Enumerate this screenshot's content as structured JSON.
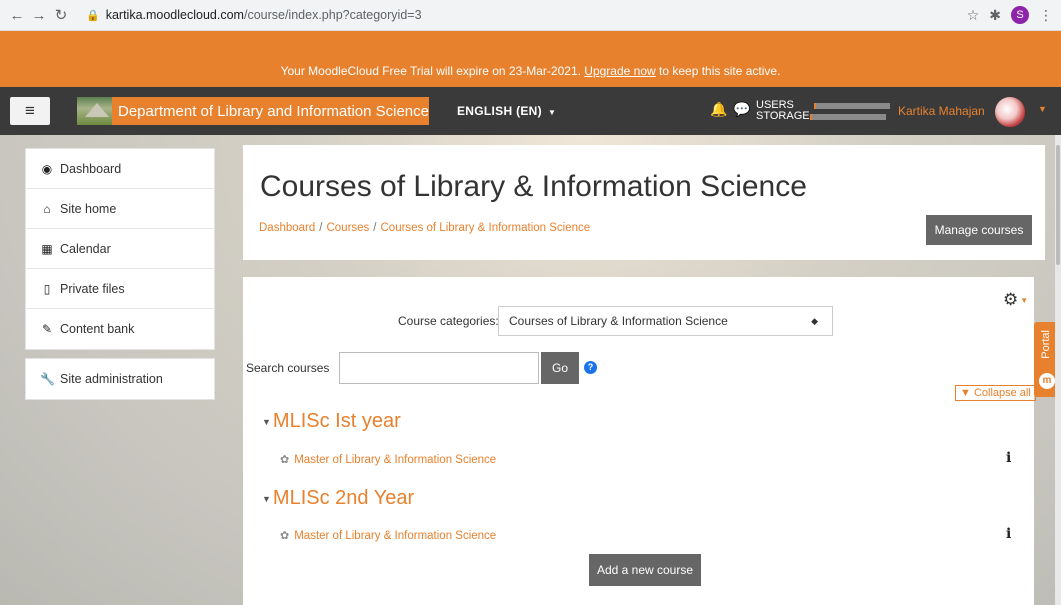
{
  "browser": {
    "url_host": "kartika.moodlecloud.com",
    "url_path": "/course/index.php?categoryid=3",
    "profile_initial": "S"
  },
  "notice": {
    "text_before": "Your MoodleCloud Free Trial will expire on 23-Mar-2021. ",
    "link": "Upgrade now",
    "text_after": " to keep this site active."
  },
  "navbar": {
    "site_name": "Department of Library and Information Science",
    "language": "ENGLISH (EN)",
    "users_label": "USERS",
    "storage_label": "STORAGE",
    "users_usage": 0.03,
    "storage_usage": 0.03,
    "user_name": "Kartika Mahajan"
  },
  "drawer": {
    "items": [
      {
        "label": "Dashboard",
        "icon": "dashboard-icon"
      },
      {
        "label": "Site home",
        "icon": "home-icon"
      },
      {
        "label": "Calendar",
        "icon": "calendar-icon"
      },
      {
        "label": "Private files",
        "icon": "file-icon"
      },
      {
        "label": "Content bank",
        "icon": "brush-icon"
      }
    ],
    "admin": {
      "label": "Site administration",
      "icon": "wrench-icon"
    }
  },
  "header": {
    "title": "Courses of Library & Information Science",
    "breadcrumb": [
      "Dashboard",
      "Courses",
      "Courses of Library & Information Science"
    ],
    "manage_button": "Manage courses"
  },
  "main": {
    "category_label": "Course categories:",
    "category_selected": "Courses of Library & Information Science",
    "search_label": "Search courses",
    "search_value": "",
    "go_button": "Go",
    "collapse_all": "Collapse all",
    "categories": [
      {
        "name": "MLISc Ist year",
        "courses": [
          "Master of Library & Information Science"
        ]
      },
      {
        "name": "MLISc 2nd Year",
        "courses": [
          "Master of Library & Information Science"
        ]
      }
    ],
    "add_course_button": "Add a new course"
  },
  "portal_tab": "Portal",
  "colors": {
    "accent": "#e8812e",
    "navbar": "#3a3a3a",
    "button": "#666666"
  }
}
